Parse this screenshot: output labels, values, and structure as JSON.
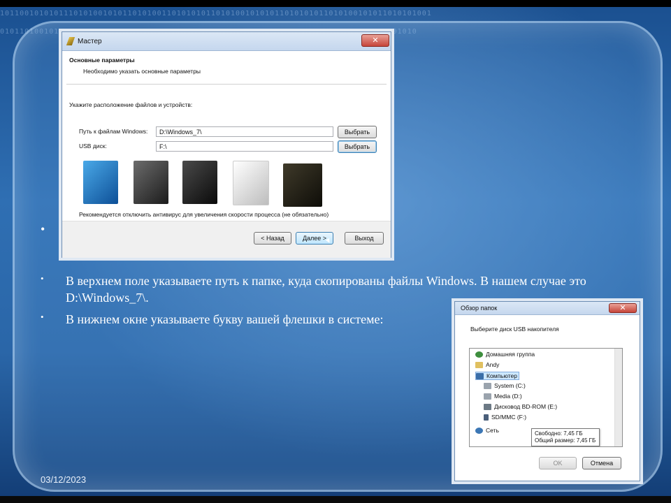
{
  "slide": {
    "bullet_symbol": "•",
    "text_1": "В верхнем поле указываете путь к папке, куда скопированы файлы Windows. В нашем случае это D:\\Windows_7\\.",
    "text_2": "В нижнем окне указываете букву вашей флешки в системе:",
    "date": "03/12/2023"
  },
  "wizard": {
    "title": "Мастер",
    "heading": "Основные параметры",
    "subheading": "Необходимо указать основные параметры",
    "prompt": "Укажите расположение файлов и устройств:",
    "windows_path_label": "Путь к файлам Windows:",
    "windows_path_value": "D:\\Windows_7\\",
    "usb_label": "USB диск:",
    "usb_value": "F:\\",
    "browse_label": "Выбрать",
    "note": "Рекомендуется отключить антивирус для увеличения скорости процесса (не обязательно)",
    "back_label": "< Назад",
    "next_label": "Далее >",
    "exit_label": "Выход",
    "close_glyph": "✕"
  },
  "browse_dialog": {
    "title": "Обзор папок",
    "prompt": "Выберите диск USB накопителя",
    "tree": [
      "Домашняя группа",
      "Andy",
      "Компьютер",
      "System (C:)",
      "Media (D:)",
      "Дисковод BD-ROM (E:)",
      "SD/MMC (F:)",
      "Сеть"
    ],
    "tooltip_free": "Свободно: 7,45 ГБ",
    "tooltip_total": "Общий размер: 7,45 ГБ",
    "ok_label": "OK",
    "cancel_label": "Отмена",
    "close_glyph": "✕"
  },
  "colors": {
    "slide_bg": "#2f6fb3",
    "text": "#ffffff",
    "selection": "#cde8ff"
  }
}
